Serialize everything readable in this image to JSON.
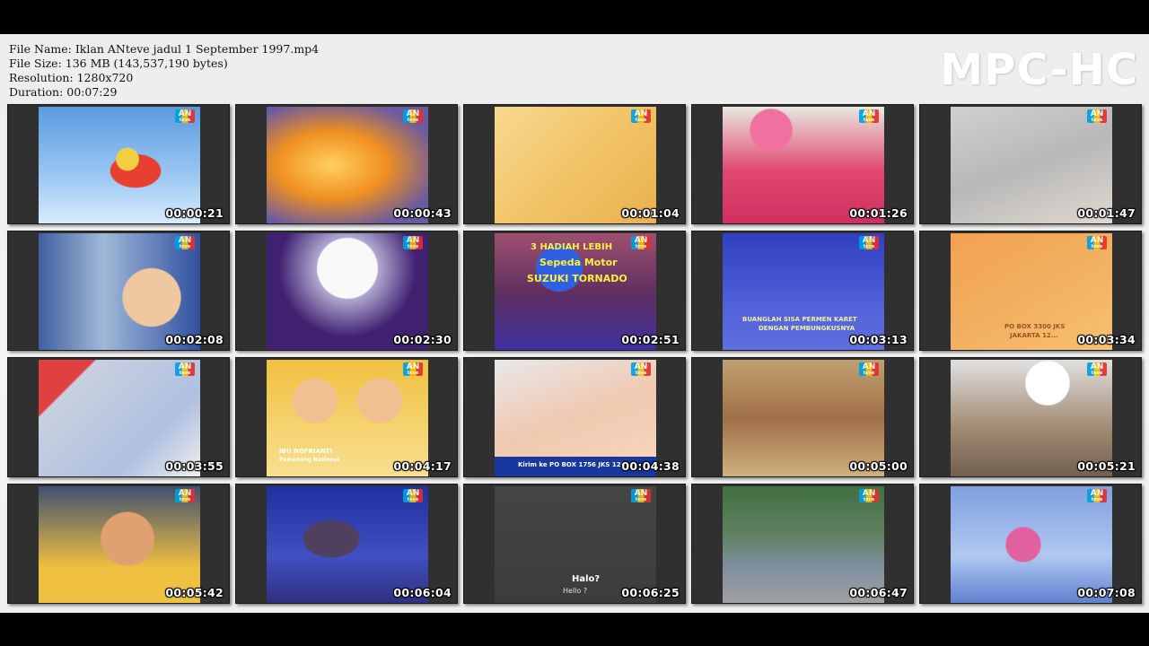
{
  "info": {
    "file_name": "File Name: Iklan ANteve jadul 1 September 1997.mp4",
    "file_size": "File Size: 136 MB (143,537,190 bytes)",
    "resolution": "Resolution: 1280x720",
    "duration": "Duration: 00:07:29"
  },
  "brand": "MPC-HC",
  "logo_text": "AN",
  "logo_sub": "teve",
  "thumbnails": [
    {
      "time": "00:00:21",
      "scene": "cartoon-airplane"
    },
    {
      "time": "00:00:43",
      "scene": "blurred-orange"
    },
    {
      "time": "00:01:04",
      "scene": "handwritten-note"
    },
    {
      "time": "00:01:26",
      "scene": "pink-helmet-worker"
    },
    {
      "time": "00:01:47",
      "scene": "hand-holding-card"
    },
    {
      "time": "00:02:08",
      "scene": "baby-window"
    },
    {
      "time": "00:02:30",
      "scene": "moon-landscape"
    },
    {
      "time": "00:02:51",
      "scene": "motorcycle-promo"
    },
    {
      "time": "00:03:13",
      "scene": "candy-wrapper-promo"
    },
    {
      "time": "00:03:34",
      "scene": "orange-envelope"
    },
    {
      "time": "00:03:55",
      "scene": "drawing-hand"
    },
    {
      "time": "00:04:17",
      "scene": "two-women-talking"
    },
    {
      "time": "00:04:38",
      "scene": "hand-with-wrapper"
    },
    {
      "time": "00:05:00",
      "scene": "elderly-woman-dining"
    },
    {
      "time": "00:05:21",
      "scene": "chef-with-bottle"
    },
    {
      "time": "00:05:42",
      "scene": "boy-eating"
    },
    {
      "time": "00:06:04",
      "scene": "blue-dark-figure"
    },
    {
      "time": "00:06:25",
      "scene": "grey-subtitle-screen"
    },
    {
      "time": "00:06:47",
      "scene": "kids-outdoors"
    },
    {
      "time": "00:07:08",
      "scene": "woman-on-phone"
    }
  ],
  "overlays": {
    "promo_line1": "3 HADIAH LEBIH",
    "promo_line2": "Sepeda Motor",
    "promo_line3": "SUZUKI TORNADO",
    "candy_line1": "BUANGLAH SISA PERMEN KARET",
    "candy_line2": "DENGAN PEMBUNGKUSNYA",
    "envelope_line1": "PO BOX 3300 JKS",
    "envelope_line2": "JAKARTA 12...",
    "caption_name": "IBU NOFRIANTI",
    "caption_sub": "Pemenang Nasional",
    "po_box": "Kirim ke PO BOX 1756 JKS 120",
    "subtitle_main": "Halo?",
    "subtitle_trans": "Hello ?"
  }
}
